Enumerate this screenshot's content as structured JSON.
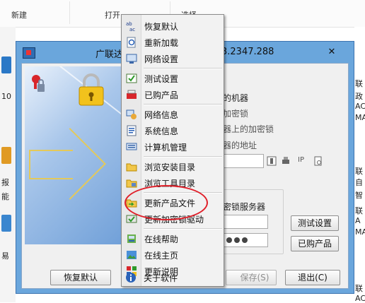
{
  "ribbon": {
    "new_label": "新建",
    "open_label": "打开",
    "select_label": "选择"
  },
  "background": {
    "left_texts": [
      "10",
      "报",
      "能",
      "易"
    ],
    "right_texts": [
      "联",
      "政",
      "AC",
      "MA",
      "联",
      "自",
      "智",
      "联",
      "A",
      "MA",
      "联",
      "AC"
    ]
  },
  "window": {
    "title": "广联达",
    "title_version": "3.2347.288",
    "close_glyph": "✕"
  },
  "panel": {
    "machine_heading": "的机器",
    "option1": "加密锁",
    "option2": "器上的加密锁",
    "option3": "器的地址",
    "ip_label": "IP",
    "server_heading": "密锁服务器",
    "test_button": "测试设置",
    "purchased_button": "已购产品",
    "restore_button": "恢复默认",
    "save_button": "保存(S)",
    "exit_button": "退出(C)"
  },
  "menu": {
    "items": [
      {
        "label": "恢复默认",
        "icon": "abc-icon"
      },
      {
        "label": "重新加载",
        "icon": "reload-icon"
      },
      {
        "label": "网络设置",
        "icon": "network-settings-icon"
      },
      {
        "label": "测试设置",
        "icon": "test-icon"
      },
      {
        "label": "已购产品",
        "icon": "products-icon"
      },
      {
        "label": "网络信息",
        "icon": "network-info-icon"
      },
      {
        "label": "系统信息",
        "icon": "system-info-icon"
      },
      {
        "label": "计算机管理",
        "icon": "computer-manage-icon"
      },
      {
        "label": "浏览安装目录",
        "icon": "folder-icon"
      },
      {
        "label": "浏览工具目录",
        "icon": "folder-tools-icon"
      },
      {
        "label": "更新产品文件",
        "icon": "update-files-icon"
      },
      {
        "label": "更新加密锁驱动",
        "icon": "update-driver-icon"
      },
      {
        "label": "在线帮助",
        "icon": "help-icon"
      },
      {
        "label": "在线主页",
        "icon": "home-icon"
      },
      {
        "label": "更新说明",
        "icon": "notes-icon"
      },
      {
        "label": "关于软件",
        "icon": "info-icon"
      }
    ]
  },
  "colors": {
    "annotation_red": "#e0202a",
    "window_border": "#6aa6dc"
  }
}
